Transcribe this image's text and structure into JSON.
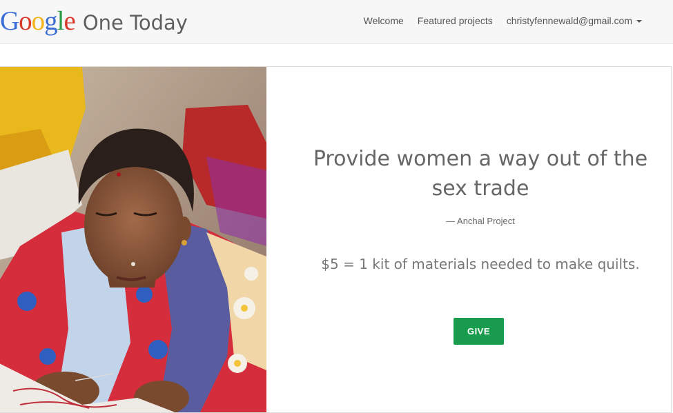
{
  "header": {
    "logo": {
      "google_letters": [
        {
          "ch": "G",
          "color": "#3b6fd6"
        },
        {
          "ch": "o",
          "color": "#d8392b"
        },
        {
          "ch": "o",
          "color": "#f3b21a"
        },
        {
          "ch": "g",
          "color": "#3b6fd6"
        },
        {
          "ch": "l",
          "color": "#2a9c46"
        },
        {
          "ch": "e",
          "color": "#d8392b"
        }
      ],
      "product_name": "One Today"
    },
    "nav": {
      "welcome": "Welcome",
      "featured": "Featured projects",
      "account": "christyfennewald@gmail.com"
    }
  },
  "project": {
    "headline": "Provide women a way out of the sex trade",
    "attribution": "— Anchal Project",
    "offer": "$5 = 1 kit of materials needed to make quilts.",
    "give_label": "GIVE"
  },
  "colors": {
    "give_button": "#1a9c4e",
    "headline_text": "#666666"
  }
}
